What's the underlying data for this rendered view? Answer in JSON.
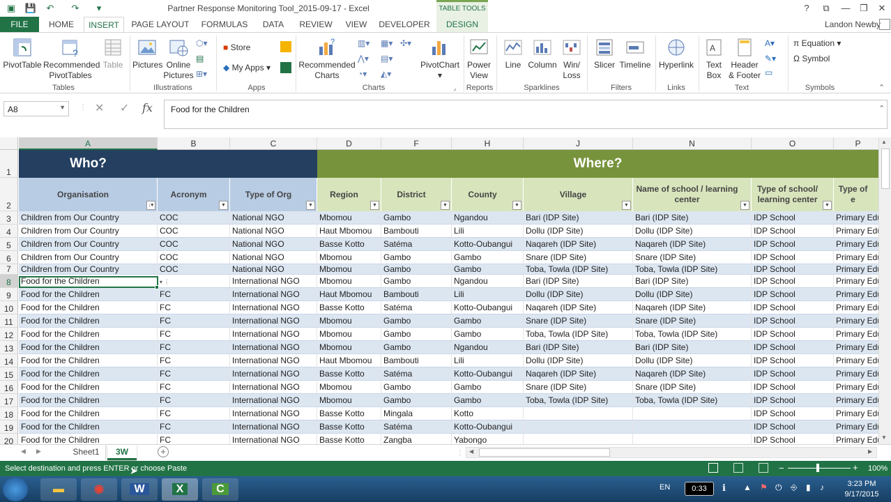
{
  "window": {
    "title": "Partner Response Monitoring Tool_2015-09-17 - Excel",
    "table_tools": "TABLE TOOLS",
    "user": "Landon Newby",
    "help": "?",
    "restore": "⧉",
    "minimize": "—",
    "maximize": "❐",
    "close": "✕"
  },
  "tabs": [
    {
      "label": "FILE"
    },
    {
      "label": "HOME"
    },
    {
      "label": "INSERT"
    },
    {
      "label": "PAGE LAYOUT"
    },
    {
      "label": "FORMULAS"
    },
    {
      "label": "DATA"
    },
    {
      "label": "REVIEW"
    },
    {
      "label": "VIEW"
    },
    {
      "label": "DEVELOPER"
    },
    {
      "label": "DESIGN"
    }
  ],
  "ribbon": {
    "pivottable": "PivotTable",
    "recommended_pivot_1": "Recommended",
    "recommended_pivot_2": "PivotTables",
    "table": "Table",
    "pictures": "Pictures",
    "online_pictures_1": "Online",
    "online_pictures_2": "Pictures",
    "store": "Store",
    "my_apps": "My Apps",
    "recommended_charts_1": "Recommended",
    "recommended_charts_2": "Charts",
    "pivotchart": "PivotChart",
    "power_view_1": "Power",
    "power_view_2": "View",
    "line": "Line",
    "column": "Column",
    "winloss_1": "Win/",
    "winloss_2": "Loss",
    "slicer": "Slicer",
    "timeline": "Timeline",
    "hyperlink": "Hyperlink",
    "textbox_1": "Text",
    "textbox_2": "Box",
    "header_footer_1": "Header",
    "header_footer_2": "& Footer",
    "equation": "Equation",
    "symbol": "Symbol",
    "groups": {
      "tables": "Tables",
      "illustrations": "Illustrations",
      "apps": "Apps",
      "charts": "Charts",
      "reports": "Reports",
      "sparklines": "Sparklines",
      "filters": "Filters",
      "links": "Links",
      "text": "Text",
      "symbols": "Symbols"
    }
  },
  "formula_bar": {
    "name_box": "A8",
    "content": "Food for the Children",
    "fx": "fx"
  },
  "columns": [
    {
      "letter": "A"
    },
    {
      "letter": "B"
    },
    {
      "letter": "C"
    },
    {
      "letter": "D"
    },
    {
      "letter": "F"
    },
    {
      "letter": "H"
    },
    {
      "letter": "J"
    },
    {
      "letter": "N"
    },
    {
      "letter": "O"
    },
    {
      "letter": "P"
    }
  ],
  "group_headers": {
    "who": "Who?",
    "where": "Where?"
  },
  "field_headers": [
    "Organisation",
    "Acronym",
    "Type of Org",
    "Region",
    "District",
    "County",
    "Village",
    "Name of school / learning center",
    "Type of school/ learning center",
    "Type of e"
  ],
  "row_numbers": [
    "1",
    "2",
    "3",
    "4",
    "5",
    "6",
    "7",
    "8",
    "9",
    "10",
    "11",
    "12",
    "13",
    "14",
    "15",
    "16",
    "17",
    "18",
    "19",
    "20"
  ],
  "rows": [
    [
      "Children from Our Country",
      "COC",
      "National NGO",
      "Mbomou",
      "Gambo",
      "Ngandou",
      "Bari (IDP Site)",
      "Bari (IDP Site)",
      "IDP School",
      "Primary Edu"
    ],
    [
      "Children from Our Country",
      "COC",
      "National NGO",
      "Haut Mbomou",
      "Bambouti",
      "Lili",
      "Dollu (IDP Site)",
      "Dollu (IDP Site)",
      "IDP School",
      "Primary Edu"
    ],
    [
      "Children from Our Country",
      "COC",
      "National NGO",
      "Basse Kotto",
      "Satéma",
      "Kotto-Oubangui",
      "Naqareh (IDP Site)",
      "Naqareh (IDP Site)",
      "IDP School",
      "Primary Edu"
    ],
    [
      "Children from Our Country",
      "COC",
      "National NGO",
      "Mbomou",
      "Gambo",
      "Gambo",
      "Snare (IDP Site)",
      "Snare (IDP Site)",
      "IDP School",
      "Primary Edu"
    ],
    [
      "Children from Our Country",
      "COC",
      "National NGO",
      "Mbomou",
      "Gambo",
      "Gambo",
      "Toba, Towla (IDP Site)",
      "Toba, Towla (IDP Site)",
      "IDP School",
      "Primary Edu"
    ],
    [
      "Food for the Children",
      "",
      "International NGO",
      "Mbomou",
      "Gambo",
      "Ngandou",
      "Bari (IDP Site)",
      "Bari (IDP Site)",
      "IDP School",
      "Primary Edu"
    ],
    [
      "Food for the Children",
      "FC",
      "International NGO",
      "Haut Mbomou",
      "Bambouti",
      "Lili",
      "Dollu (IDP Site)",
      "Dollu (IDP Site)",
      "IDP School",
      "Primary Edu"
    ],
    [
      "Food for the Children",
      "FC",
      "International NGO",
      "Basse Kotto",
      "Satéma",
      "Kotto-Oubangui",
      "Naqareh (IDP Site)",
      "Naqareh (IDP Site)",
      "IDP School",
      "Primary Edu"
    ],
    [
      "Food for the Children",
      "FC",
      "International NGO",
      "Mbomou",
      "Gambo",
      "Gambo",
      "Snare (IDP Site)",
      "Snare (IDP Site)",
      "IDP School",
      "Primary Edu"
    ],
    [
      "Food for the Children",
      "FC",
      "International NGO",
      "Mbomou",
      "Gambo",
      "Gambo",
      "Toba, Towla (IDP Site)",
      "Toba, Towla (IDP Site)",
      "IDP School",
      "Primary Edu"
    ],
    [
      "Food for the Children",
      "FC",
      "International NGO",
      "Mbomou",
      "Gambo",
      "Ngandou",
      "Bari (IDP Site)",
      "Bari (IDP Site)",
      "IDP School",
      "Primary Edu"
    ],
    [
      "Food for the Children",
      "FC",
      "International NGO",
      "Haut Mbomou",
      "Bambouti",
      "Lili",
      "Dollu (IDP Site)",
      "Dollu (IDP Site)",
      "IDP School",
      "Primary Edu"
    ],
    [
      "Food for the Children",
      "FC",
      "International NGO",
      "Basse Kotto",
      "Satéma",
      "Kotto-Oubangui",
      "Naqareh (IDP Site)",
      "Naqareh (IDP Site)",
      "IDP School",
      "Primary Edu"
    ],
    [
      "Food for the Children",
      "FC",
      "International NGO",
      "Mbomou",
      "Gambo",
      "Gambo",
      "Snare (IDP Site)",
      "Snare (IDP Site)",
      "IDP School",
      "Primary Edu"
    ],
    [
      "Food for the Children",
      "FC",
      "International NGO",
      "Mbomou",
      "Gambo",
      "Gambo",
      "Toba, Towla (IDP Site)",
      "Toba, Towla (IDP Site)",
      "IDP School",
      "Primary Edu"
    ],
    [
      "Food for the Children",
      "FC",
      "International NGO",
      "Basse Kotto",
      "Mingala",
      "Kotto",
      "",
      "",
      "IDP School",
      "Primary Edu"
    ],
    [
      "Food for the Children",
      "FC",
      "International NGO",
      "Basse Kotto",
      "Satéma",
      "Kotto-Oubangui",
      "",
      "",
      "IDP School",
      "Primary Edu"
    ],
    [
      "Food for the Children",
      "FC",
      "International NGO",
      "Basse Kotto",
      "Zangba",
      "Yabongo",
      "",
      "",
      "IDP School",
      "Primary Edu"
    ]
  ],
  "sheets": [
    {
      "name": "Sheet1"
    },
    {
      "name": "3W"
    }
  ],
  "status": {
    "message": "Select destination and press ENTER or choose Paste",
    "zoom": "100%"
  },
  "taskbar": {
    "lang": "EN",
    "timer": "0:33",
    "time": "3:23 PM",
    "date": "9/17/2015"
  }
}
